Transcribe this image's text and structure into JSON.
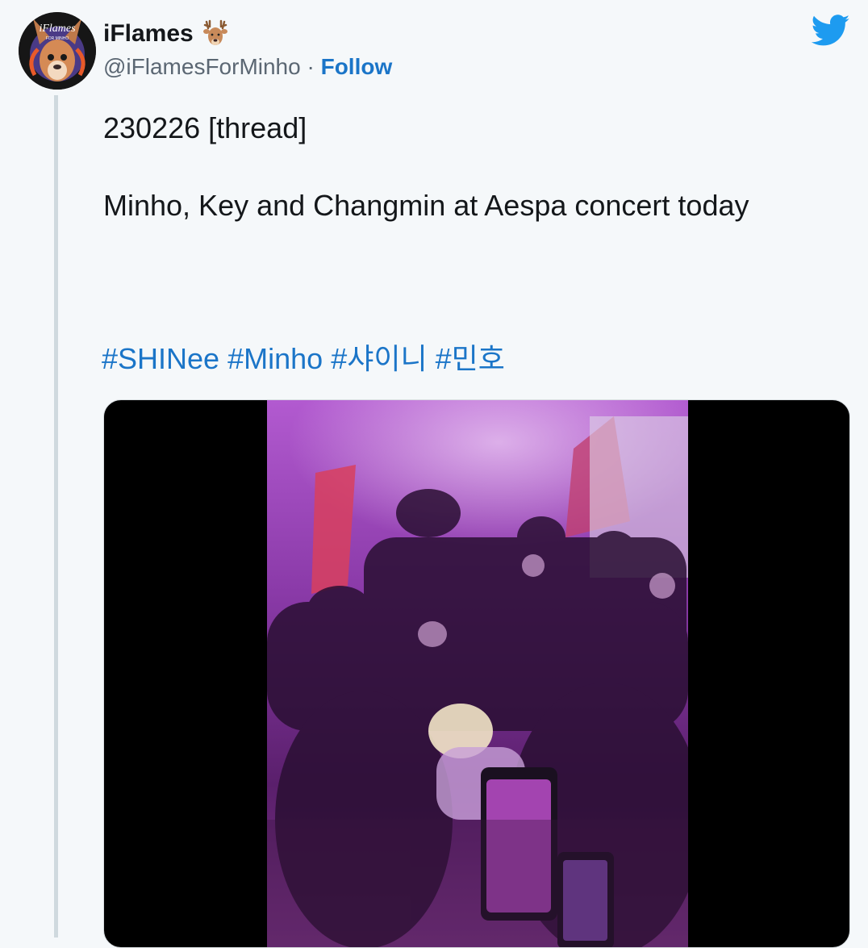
{
  "author": {
    "display_name": "iFlames",
    "handle": "@iFlamesForMinho",
    "separator": "·",
    "follow_label": "Follow",
    "avatar_text": "iFlames",
    "avatar_subtext": "FOR MINHO"
  },
  "tweet": {
    "line1": "230226 [thread]",
    "line2": "Minho, Key and Changmin at Aespa concert today",
    "hashtags": [
      "#SHINee",
      "#Minho",
      "#샤이니",
      "#민호"
    ]
  },
  "icons": {
    "deer": "deer-emoji-icon",
    "twitter": "twitter-bird-icon"
  },
  "colors": {
    "link": "#1b75c8",
    "twitter_blue": "#1d9bf0",
    "background": "#f5f8fa",
    "text": "#14171a",
    "secondary": "#5b6773"
  },
  "media": {
    "type": "video",
    "description_icon": "concert-video-frame"
  }
}
